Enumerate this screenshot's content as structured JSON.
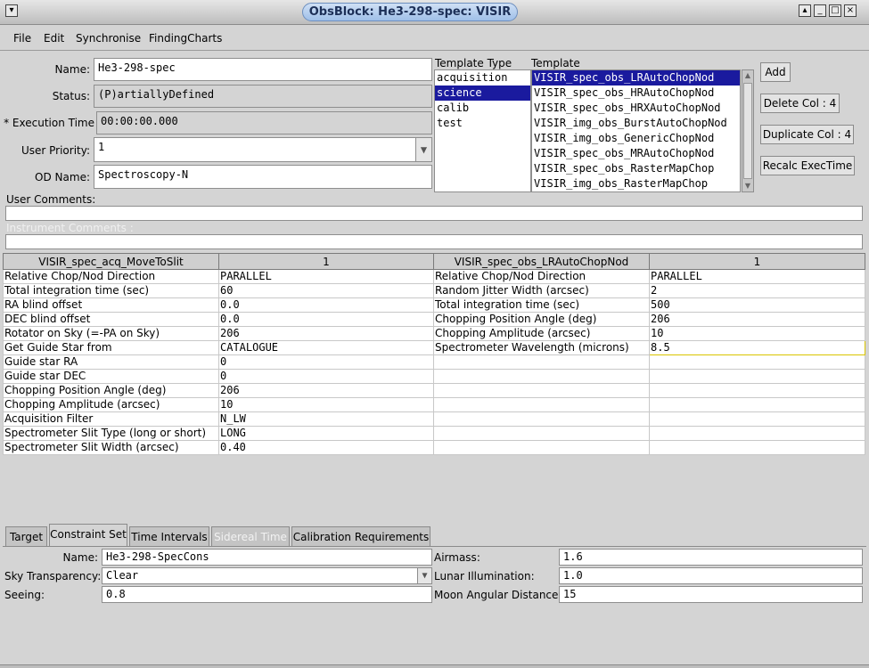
{
  "window": {
    "title": "ObsBlock: He3-298-spec: VISIR"
  },
  "menu": [
    "File",
    "Edit",
    "Synchronise",
    "FindingCharts"
  ],
  "form": {
    "name_label": "Name:",
    "name_value": "He3-298-spec",
    "status_label": "Status:",
    "status_value": "(P)artiallyDefined",
    "exec_label": "* Execution Time",
    "exec_value": "00:00:00.000",
    "priority_label": "User Priority:",
    "priority_value": "1",
    "od_label": "OD Name:",
    "od_value": "Spectroscopy-N",
    "user_comments_label": "User Comments:",
    "instrument_comments_label": "Instrument Comments :"
  },
  "template_type": {
    "header": "Template Type",
    "items": [
      "acquisition",
      "science",
      "calib",
      "test"
    ],
    "selected": "science"
  },
  "template": {
    "header": "Template",
    "items": [
      "VISIR_spec_obs_LRAutoChopNod",
      "VISIR_spec_obs_HRAutoChopNod",
      "VISIR_spec_obs_HRXAutoChopNod",
      "VISIR_img_obs_BurstAutoChopNod",
      "VISIR_img_obs_GenericChopNod",
      "VISIR_spec_obs_MRAutoChopNod",
      "VISIR_spec_obs_RasterMapChop",
      "VISIR_img_obs_RasterMapChop"
    ],
    "selected": "VISIR_spec_obs_LRAutoChopNod"
  },
  "buttons": {
    "add": "Add",
    "delete_col": "Delete Col : 4",
    "duplicate_col": "Duplicate Col : 4",
    "recalc": "Recalc ExecTime"
  },
  "table": {
    "headers": [
      "VISIR_spec_acq_MoveToSlit",
      "1",
      "VISIR_spec_obs_LRAutoChopNod",
      "1"
    ],
    "rows": [
      [
        "Relative Chop/Nod Direction",
        "PARALLEL",
        "Relative Chop/Nod Direction",
        "PARALLEL"
      ],
      [
        "Total integration time (sec)",
        "60",
        "Random Jitter Width (arcsec)",
        "2"
      ],
      [
        "RA blind offset",
        "0.0",
        "Total integration time (sec)",
        "500"
      ],
      [
        "DEC blind offset",
        "0.0",
        "Chopping Position Angle (deg)",
        "206"
      ],
      [
        "Rotator on Sky (=-PA on Sky)",
        "206",
        "Chopping Amplitude (arcsec)",
        "10"
      ],
      [
        "Get Guide Star from",
        "CATALOGUE",
        "Spectrometer Wavelength (microns)",
        "8.5"
      ],
      [
        "Guide star RA",
        "0",
        "",
        ""
      ],
      [
        "Guide star DEC",
        "0",
        "",
        ""
      ],
      [
        "Chopping Position Angle (deg)",
        "206",
        "",
        ""
      ],
      [
        "Chopping Amplitude (arcsec)",
        "10",
        "",
        ""
      ],
      [
        "Acquisition Filter",
        "N_LW",
        "",
        ""
      ],
      [
        "Spectrometer Slit Type (long or short)",
        "LONG",
        "",
        ""
      ],
      [
        "Spectrometer Slit Width (arcsec)",
        "0.40",
        "",
        ""
      ]
    ]
  },
  "tabs": [
    {
      "label": "Target",
      "state": "normal"
    },
    {
      "label": "Constraint Set",
      "state": "active"
    },
    {
      "label": "Time Intervals",
      "state": "normal"
    },
    {
      "label": "Sidereal Time",
      "state": "disabled"
    },
    {
      "label": "Calibration Requirements",
      "state": "normal"
    }
  ],
  "constraints": {
    "name_label": "Name:",
    "name_value": "He3-298-SpecCons",
    "sky_label": "Sky Transparency:",
    "sky_value": "Clear",
    "seeing_label": "Seeing:",
    "seeing_value": "0.8",
    "airmass_label": "Airmass:",
    "airmass_value": "1.6",
    "lunar_label": "Lunar Illumination:",
    "lunar_value": "1.0",
    "moon_label": "Moon Angular Distance:",
    "moon_value": "15"
  },
  "colors": {
    "selection": "#1a1a9e",
    "title_pill": "#9fbfe8",
    "highlight_border": "#d9c400"
  }
}
